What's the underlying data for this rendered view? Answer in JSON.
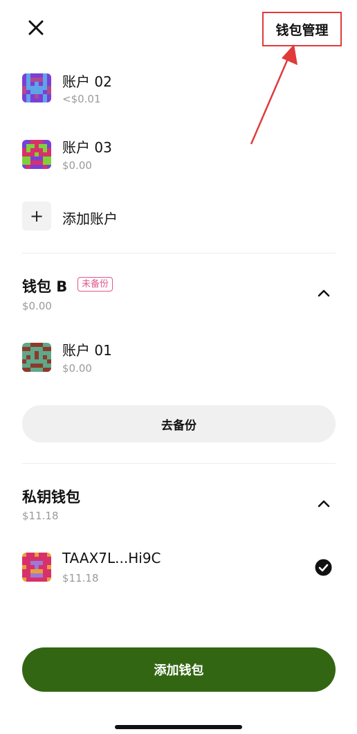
{
  "header": {
    "manage_label": "钱包管理"
  },
  "wallet_a": {
    "accounts": [
      {
        "name": "账户 02",
        "balance": "<$0.01"
      },
      {
        "name": "账户 03",
        "balance": "$0.00"
      }
    ],
    "add_account_label": "添加账户"
  },
  "wallet_b": {
    "title": "钱包 B",
    "badge": "未备份",
    "balance": "$0.00",
    "accounts": [
      {
        "name": "账户 01",
        "balance": "$0.00"
      }
    ],
    "backup_label": "去备份"
  },
  "private_key_wallet": {
    "title": "私钥钱包",
    "balance": "$11.18",
    "accounts": [
      {
        "name": "TAAX7L...Hi9C",
        "balance": "$11.18",
        "selected": true
      }
    ]
  },
  "footer": {
    "add_wallet_label": "添加钱包"
  },
  "colors": {
    "accent_green": "#336612",
    "annotation_red": "#e03a3a",
    "badge_pink": "#e0578a"
  }
}
